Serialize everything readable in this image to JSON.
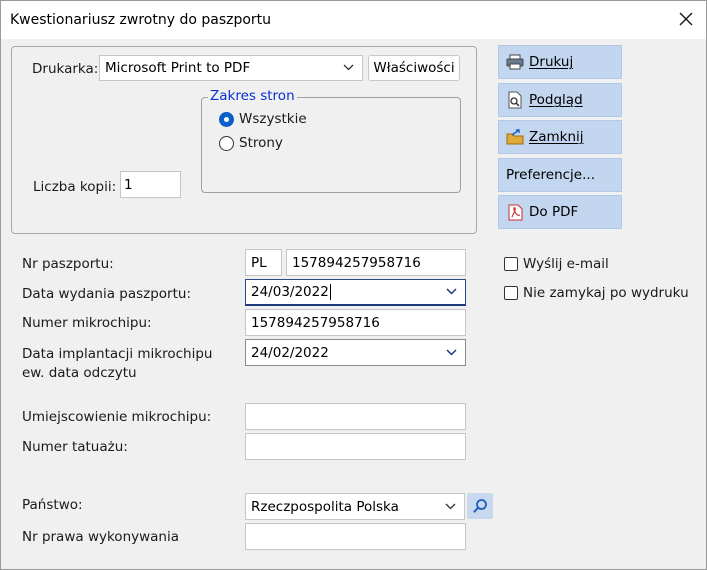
{
  "window": {
    "title": "Kwestionariusz zwrotny do paszportu"
  },
  "printer": {
    "label": "Drukarka:",
    "selected": "Microsoft Print to PDF",
    "properties_button": "Właściwości",
    "range": {
      "title": "Zakres stron",
      "option_all": "Wszystkie",
      "option_pages": "Strony"
    },
    "copies_label": "Liczba kopii:",
    "copies_value": "1"
  },
  "actions": {
    "print": "Drukuj",
    "preview": "Podgląd",
    "close": "Zamknij",
    "preferences": "Preferencje...",
    "to_pdf": "Do PDF"
  },
  "options": {
    "send_email": "Wyślij e-mail",
    "keep_open": "Nie zamykaj po wydruku"
  },
  "form": {
    "passport_no_label": "Nr paszportu:",
    "passport_prefix": "PL",
    "passport_no": "157894257958716",
    "issue_date_label": "Data wydania paszportu:",
    "issue_date": "24/03/2022",
    "microchip_no_label": "Numer mikrochipu:",
    "microchip_no": "157894257958716",
    "implant_date_label_1": "Data implantacji mikrochipu",
    "implant_date_label_2": "ew. data odczytu",
    "implant_date": "24/02/2022",
    "microchip_location_label": "Umiejscowienie mikrochipu:",
    "microchip_location": "",
    "tattoo_no_label": "Numer tatuażu:",
    "tattoo_no": "",
    "country_label": "Państwo:",
    "country": "Rzeczpospolita Polska",
    "license_label": "Nr prawa wykonywania",
    "license_no": ""
  }
}
